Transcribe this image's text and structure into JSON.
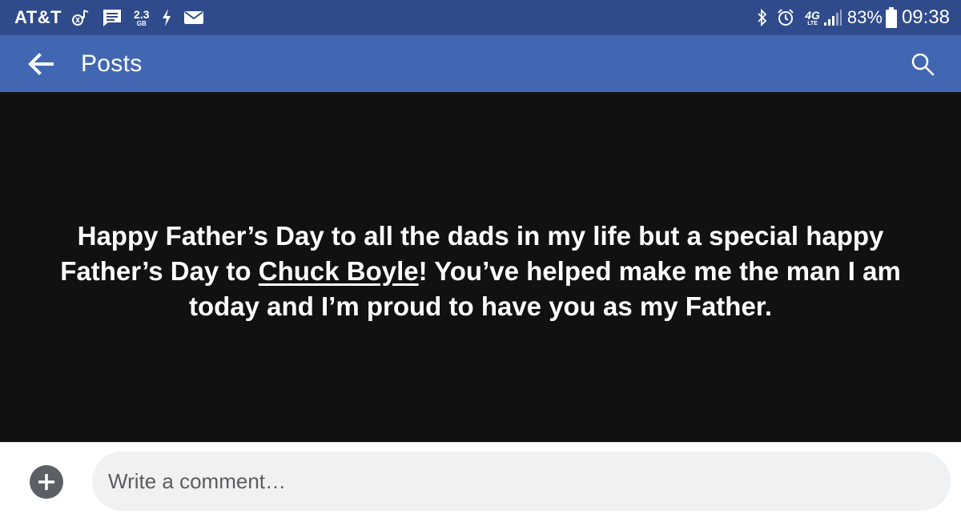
{
  "status_bar": {
    "carrier": "AT&T",
    "data_usage_value": "2.3",
    "data_usage_unit": "GB",
    "network_type": "4G",
    "network_sub": "LTE",
    "battery_percent": "83%",
    "time": "09:38",
    "icons": [
      "music-bluetooth-icon",
      "message-icon",
      "data-usage-icon",
      "charging-icon",
      "mail-icon",
      "bluetooth-icon",
      "alarm-icon",
      "network-4g-lte-icon",
      "signal-icon",
      "battery-icon"
    ]
  },
  "app_bar": {
    "title": "Posts",
    "back_icon": "arrow-left-icon",
    "search_icon": "search-icon",
    "background": "#4267b2"
  },
  "post": {
    "text_before": "Happy Father’s Day to all the dads in my life but a special happy Father’s Day to ",
    "mention": "Chuck Boyle",
    "text_after": "! You’ve helped make me the man I am today and I’m proud to have you as my Father.",
    "background": "#111111",
    "text_color": "#ffffff"
  },
  "comment_bar": {
    "placeholder": "Write a comment…",
    "value": "",
    "add_icon": "plus-circle-icon"
  }
}
